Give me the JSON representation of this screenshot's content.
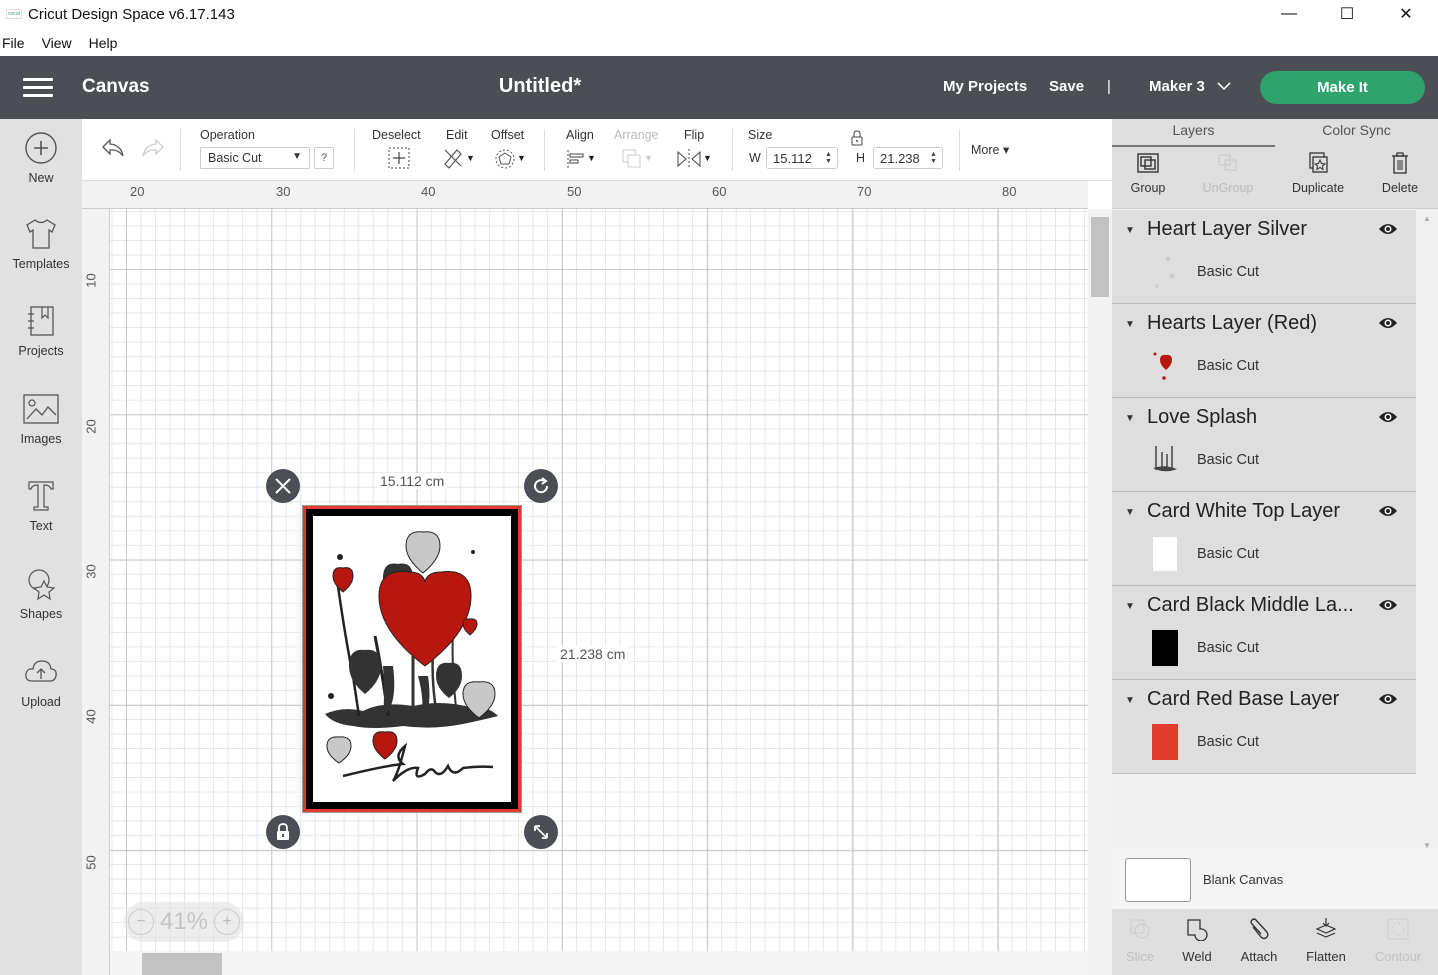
{
  "window": {
    "title": "Cricut Design Space  v6.17.143",
    "logo_text": "cricut",
    "controls": {
      "minimize": "—",
      "maximize": "☐",
      "close": "✕"
    }
  },
  "menu": {
    "items": [
      "File",
      "View",
      "Help"
    ]
  },
  "header": {
    "section": "Canvas",
    "project_title": "Untitled*",
    "my_projects": "My Projects",
    "save": "Save",
    "divider": "|",
    "machine": "Maker 3",
    "make_it": "Make It",
    "accent_color": "#2ea36d"
  },
  "sidebar": {
    "items": [
      {
        "label": "New",
        "icon": "plus-circle-icon"
      },
      {
        "label": "Templates",
        "icon": "tshirt-icon"
      },
      {
        "label": "Projects",
        "icon": "notebook-icon"
      },
      {
        "label": "Images",
        "icon": "image-icon"
      },
      {
        "label": "Text",
        "icon": "text-icon"
      },
      {
        "label": "Shapes",
        "icon": "shapes-icon"
      },
      {
        "label": "Upload",
        "icon": "cloud-upload-icon"
      }
    ]
  },
  "toolbar": {
    "operation_label": "Operation",
    "operation_value": "Basic Cut",
    "help": "?",
    "deselect": "Deselect",
    "edit": "Edit",
    "offset": "Offset",
    "align": "Align",
    "arrange": "Arrange",
    "flip": "Flip",
    "size_label": "Size",
    "w_label": "W",
    "w_value": "15.112",
    "h_label": "H",
    "h_value": "21.238",
    "more": "More ▾"
  },
  "rulers": {
    "horizontal": [
      "20",
      "30",
      "40",
      "50",
      "60",
      "70",
      "80"
    ],
    "vertical": [
      "10",
      "20",
      "30",
      "40",
      "50"
    ]
  },
  "canvas": {
    "width_label": "15.112 cm",
    "height_label": "21.238 cm",
    "zoom": "41%",
    "zoom_out": "−",
    "zoom_in": "+"
  },
  "panel": {
    "tabs": [
      "Layers",
      "Color Sync"
    ],
    "actions": [
      {
        "label": "Group",
        "enabled": true
      },
      {
        "label": "UnGroup",
        "enabled": false
      },
      {
        "label": "Duplicate",
        "enabled": true
      },
      {
        "label": "Delete",
        "enabled": true
      }
    ],
    "layers": [
      {
        "name": "Heart Layer Silver",
        "operation": "Basic Cut",
        "color": "#cfcfcf"
      },
      {
        "name": "Hearts Layer (Red)",
        "operation": "Basic Cut",
        "color": "#b8170f"
      },
      {
        "name": "Love Splash",
        "operation": "Basic Cut",
        "color": "#333333"
      },
      {
        "name": "Card White Top Layer",
        "operation": "Basic Cut",
        "color": "#ffffff"
      },
      {
        "name": "Card Black Middle La...",
        "operation": "Basic Cut",
        "color": "#000000"
      },
      {
        "name": "Card Red Base Layer",
        "operation": "Basic Cut",
        "color": "#e23b2e"
      }
    ],
    "blank_canvas": "Blank Canvas",
    "bottom_actions": [
      {
        "label": "Slice",
        "enabled": false
      },
      {
        "label": "Weld",
        "enabled": true
      },
      {
        "label": "Attach",
        "enabled": true
      },
      {
        "label": "Flatten",
        "enabled": true
      },
      {
        "label": "Contour",
        "enabled": false
      }
    ]
  }
}
